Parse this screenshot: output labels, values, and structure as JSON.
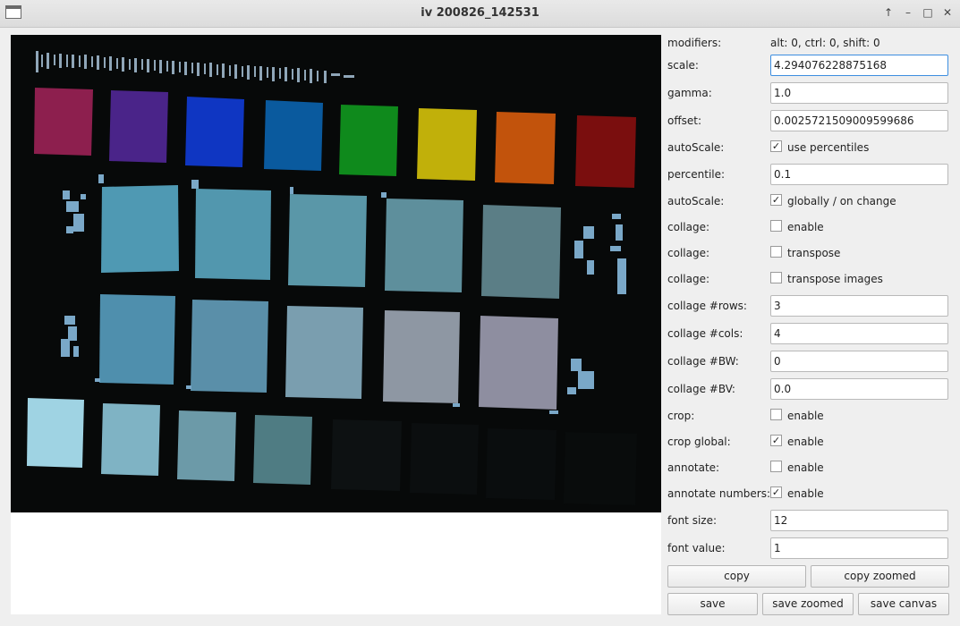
{
  "window": {
    "title": "iv 200826_142531"
  },
  "titlebar_buttons": [
    "↑",
    "–",
    "□",
    "✕"
  ],
  "panel": {
    "modifiers_label": "modifiers:",
    "modifiers_value": "alt: 0, ctrl: 0, shift: 0",
    "scale_label": "scale:",
    "scale_value": "4.294076228875168",
    "gamma_label": "gamma:",
    "gamma_value": "1.0",
    "offset_label": "offset:",
    "offset_value": "0.0025721509009599686",
    "autoscale1_label": "autoScale:",
    "autoscale1_text": "use percentiles",
    "autoscale1_checked": true,
    "percentile_label": "percentile:",
    "percentile_value": "0.1",
    "autoscale2_label": "autoScale:",
    "autoscale2_text": "globally / on change",
    "autoscale2_checked": true,
    "collage_enable_label": "collage:",
    "collage_enable_text": "enable",
    "collage_enable_checked": false,
    "collage_transpose_label": "collage:",
    "collage_transpose_text": "transpose",
    "collage_transpose_checked": false,
    "collage_transpose_images_label": "collage:",
    "collage_transpose_images_text": "transpose images",
    "collage_transpose_images_checked": false,
    "collage_rows_label": "collage #rows:",
    "collage_rows_value": "3",
    "collage_cols_label": "collage #cols:",
    "collage_cols_value": "4",
    "collage_bw_label": "collage #BW:",
    "collage_bw_value": "0",
    "collage_bv_label": "collage #BV:",
    "collage_bv_value": "0.0",
    "crop_label": "crop:",
    "crop_text": "enable",
    "crop_checked": false,
    "crop_global_label": "crop global:",
    "crop_global_text": "enable",
    "crop_global_checked": true,
    "annotate_label": "annotate:",
    "annotate_text": "enable",
    "annotate_checked": false,
    "annotate_numbers_label": "annotate numbers:",
    "annotate_numbers_text": "enable",
    "annotate_numbers_checked": true,
    "font_size_label": "font size:",
    "font_size_value": "12",
    "font_value_label": "font value:",
    "font_value_value": "1"
  },
  "buttons": {
    "copy": "copy",
    "copy_zoomed": "copy zoomed",
    "save": "save",
    "save_zoomed": "save zoomed",
    "save_canvas": "save canvas"
  }
}
